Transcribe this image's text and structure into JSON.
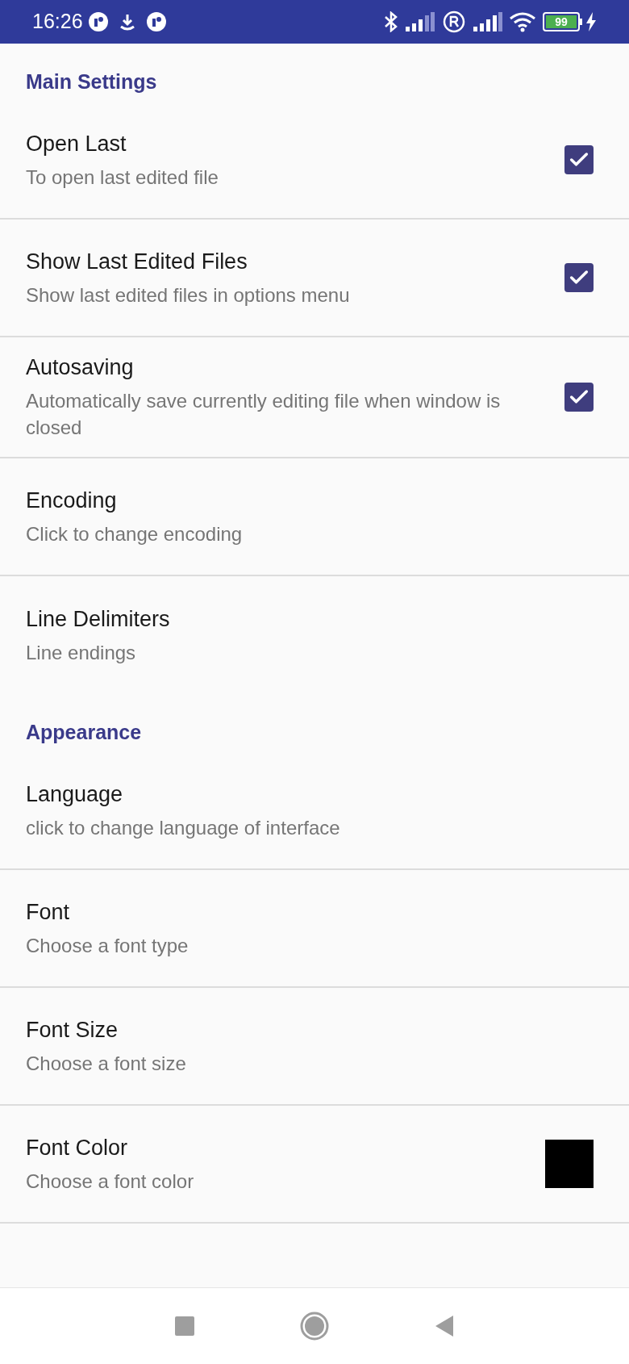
{
  "status_bar": {
    "time": "16:26",
    "battery": "99"
  },
  "sections": [
    {
      "title": "Main Settings",
      "items": [
        {
          "kind": "checkbox",
          "title": "Open Last",
          "subtitle": "To open last edited file",
          "checked": true
        },
        {
          "kind": "checkbox",
          "title": "Show Last Edited Files",
          "subtitle": "Show last edited files in options menu",
          "checked": true
        },
        {
          "kind": "checkbox",
          "title": "Autosaving",
          "subtitle": "Automatically save currently editing file when window is closed",
          "checked": true
        },
        {
          "kind": "plain",
          "title": "Encoding",
          "subtitle": "Click to change encoding"
        },
        {
          "kind": "plain",
          "title": "Line Delimiters",
          "subtitle": "Line endings"
        }
      ]
    },
    {
      "title": "Appearance",
      "items": [
        {
          "kind": "plain",
          "title": "Language",
          "subtitle": "click to change language of interface"
        },
        {
          "kind": "plain",
          "title": "Font",
          "subtitle": "Choose a font type"
        },
        {
          "kind": "plain",
          "title": "Font Size",
          "subtitle": "Choose a font size"
        },
        {
          "kind": "swatch",
          "title": "Font Color",
          "subtitle": "Choose a font color",
          "color": "#000000"
        }
      ]
    }
  ]
}
